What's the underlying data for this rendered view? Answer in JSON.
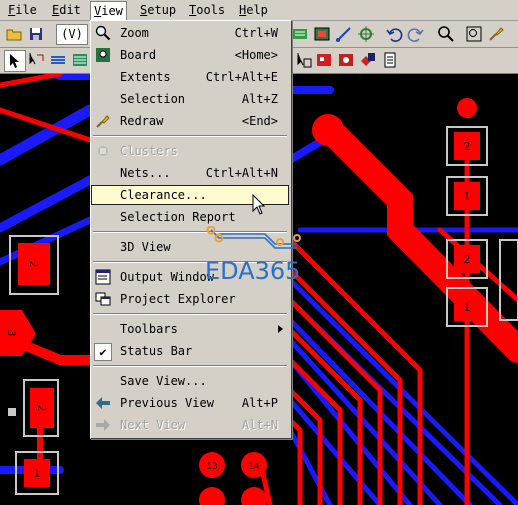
{
  "menubar": {
    "items": [
      {
        "label": "File",
        "ul": "F",
        "rest": "ile"
      },
      {
        "label": "Edit",
        "ul": "E",
        "rest": "dit"
      },
      {
        "label": "View",
        "ul": "V",
        "rest": "iew"
      },
      {
        "label": "Setup",
        "ul": "S",
        "rest": "etup"
      },
      {
        "label": "Tools",
        "ul": "T",
        "rest": "ools"
      },
      {
        "label": "Help",
        "ul": "H",
        "rest": "elp"
      }
    ],
    "active": "View"
  },
  "toolbar": {
    "combo_value": "(V)"
  },
  "view_menu": {
    "items": [
      {
        "label": "Zoom",
        "shortcut": "Ctrl+W",
        "icon": "magnifier-icon",
        "disabled": false
      },
      {
        "label": "Board",
        "shortcut": "<Home>",
        "icon": "",
        "disabled": false
      },
      {
        "label": "Extents",
        "shortcut": "Ctrl+Alt+E",
        "icon": "",
        "disabled": false
      },
      {
        "label": "Selection",
        "shortcut": "Alt+Z",
        "icon": "",
        "disabled": false
      },
      {
        "label": "Redraw",
        "shortcut": "<End>",
        "icon": "brush-icon",
        "disabled": false
      },
      {
        "label": "Clusters",
        "shortcut": "",
        "icon": "clusters-icon",
        "disabled": true
      },
      {
        "label": "Nets...",
        "shortcut": "Ctrl+Alt+N",
        "icon": "",
        "disabled": false
      },
      {
        "label": "Clearance...",
        "shortcut": "",
        "icon": "",
        "disabled": false,
        "highlighted": true
      },
      {
        "label": "Selection Report",
        "shortcut": "",
        "icon": "",
        "disabled": false
      },
      {
        "label": "3D View",
        "shortcut": "",
        "icon": "",
        "disabled": false
      },
      {
        "label": "Output Window",
        "shortcut": "",
        "icon": "output-window-icon",
        "disabled": false
      },
      {
        "label": "Project Explorer",
        "shortcut": "",
        "icon": "project-explorer-icon",
        "disabled": false
      },
      {
        "label": "Toolbars",
        "shortcut": "",
        "icon": "",
        "disabled": false,
        "submenu": true
      },
      {
        "label": "Status Bar",
        "shortcut": "",
        "icon": "",
        "disabled": false,
        "checked": true
      },
      {
        "label": "Save View...",
        "shortcut": "",
        "icon": "",
        "disabled": false
      },
      {
        "label": "Previous View",
        "shortcut": "Alt+P",
        "icon": "back-arrow-icon",
        "disabled": false
      },
      {
        "label": "Next View",
        "shortcut": "Alt+N",
        "icon": "forward-arrow-icon",
        "disabled": true
      }
    ]
  },
  "pads": [
    "2",
    "1",
    "2",
    "1",
    "2",
    "3",
    "2",
    "1",
    "13",
    "14"
  ],
  "watermark": {
    "text": "EDA365"
  },
  "colors": {
    "menu_bg": "#d4d0c8",
    "highlight": "#fffbd0",
    "trace_red": "#ff0000",
    "trace_blue": "#1a1aff",
    "board_bg": "#000000",
    "pad_outline": "#c8c8c8"
  }
}
